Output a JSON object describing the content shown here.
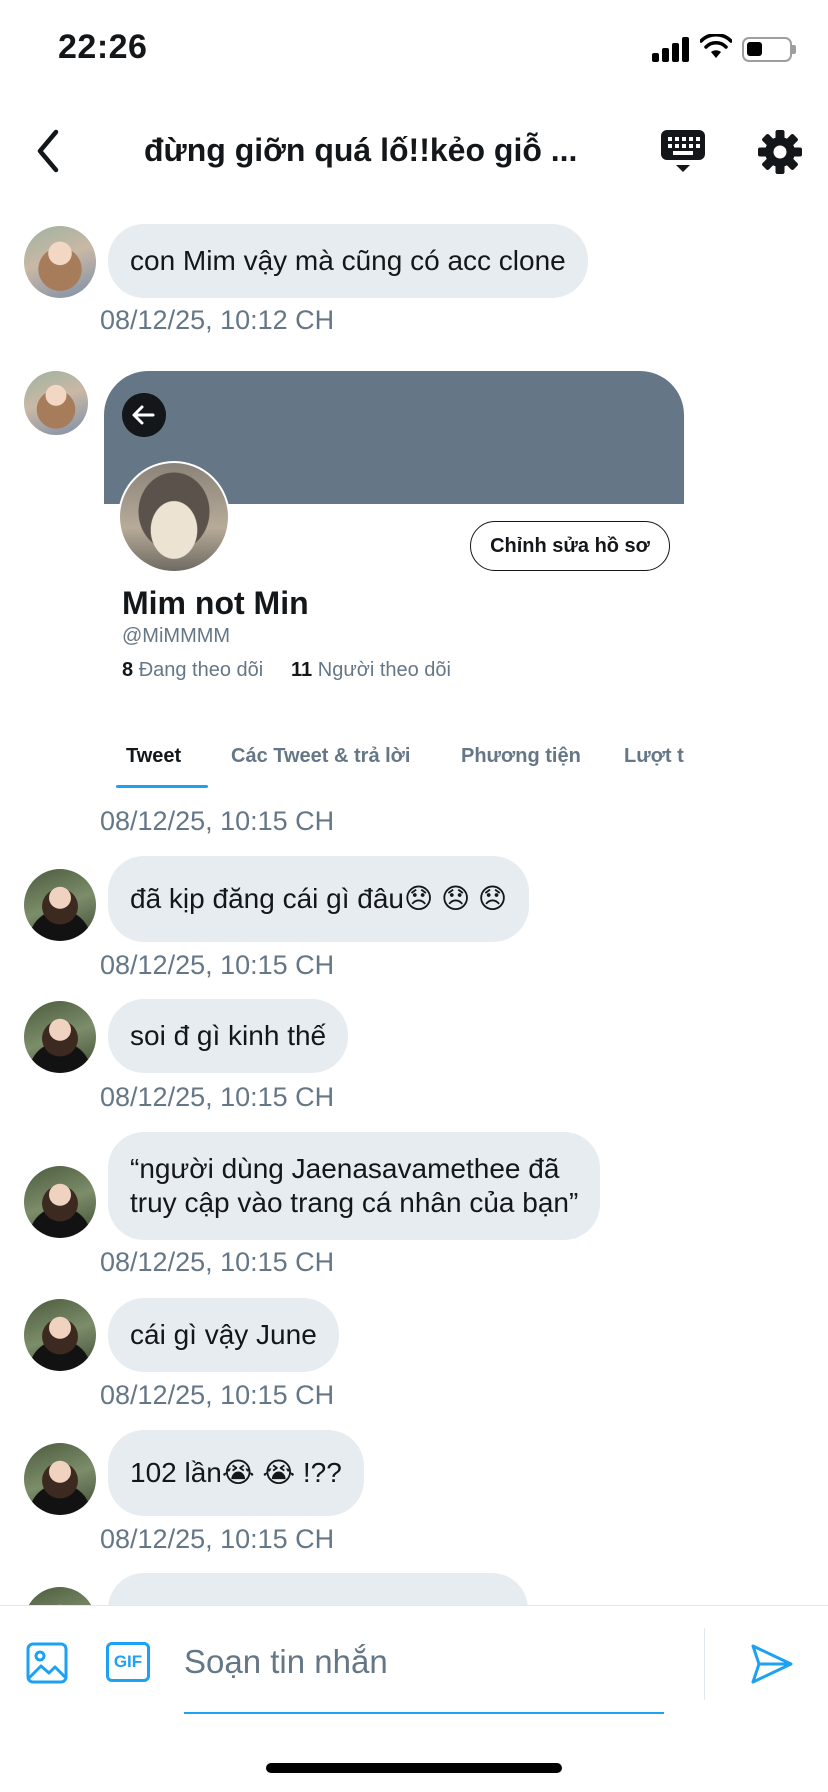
{
  "status_bar": {
    "time": "22:26"
  },
  "header": {
    "title": "đừng giỡn quá lố!!kẻo giỗ ..."
  },
  "messages": [
    {
      "text": "con Mim vậy mà cũng có acc clone",
      "timestamp": "08/12/25, 10:12 CH"
    },
    {
      "timestamp": "08/12/25, 10:15 CH"
    },
    {
      "text": "đã kịp đăng cái gì đâu😞 😞 😞",
      "timestamp": "08/12/25, 10:15 CH"
    },
    {
      "text": "soi đ gì kinh thế",
      "timestamp": "08/12/25, 10:15 CH"
    },
    {
      "line1": "“người dùng Jaenasavamethee đã",
      "line2": "truy cập vào trang cá nhân của bạn”",
      "timestamp": "08/12/25, 10:15 CH"
    },
    {
      "text": "cái gì vậy June",
      "timestamp": "08/12/25, 10:15 CH"
    },
    {
      "text": "102 lần😭 😭 !??",
      "timestamp": "08/12/25, 10:15 CH"
    }
  ],
  "profile_card": {
    "edit_button": "Chỉnh sửa hồ sơ",
    "name": "Mim not Min",
    "handle": "@MiMMMM",
    "following_count": "8",
    "following_label": "Đang theo dõi",
    "followers_count": "11",
    "followers_label": "Người theo dõi",
    "tabs": [
      "Tweet",
      "Các Tweet & trả lời",
      "Phương tiện",
      "Lượt t"
    ]
  },
  "composer": {
    "gif_label": "GIF",
    "placeholder": "Soạn tin nhắn"
  },
  "colors": {
    "accent": "#1da1f2",
    "bubble": "#e6ecf0",
    "banner": "#657786",
    "secondary_text": "#657786"
  }
}
